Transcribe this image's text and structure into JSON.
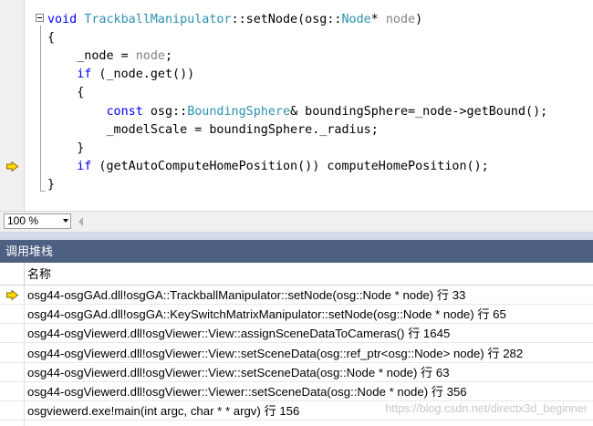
{
  "editor": {
    "lines": [
      {
        "tokens": [
          {
            "t": "void ",
            "c": "kw"
          },
          {
            "t": "TrackballManipulator",
            "c": "ty"
          },
          {
            "t": "::setNode(osg::",
            "c": ""
          },
          {
            "t": "Node",
            "c": "ty"
          },
          {
            "t": "* ",
            "c": ""
          },
          {
            "t": "node",
            "c": "gr"
          },
          {
            "t": ")",
            "c": ""
          }
        ]
      },
      {
        "tokens": [
          {
            "t": "{",
            "c": ""
          }
        ]
      },
      {
        "tokens": [
          {
            "t": "    _node = ",
            "c": ""
          },
          {
            "t": "node",
            "c": "gr"
          },
          {
            "t": ";",
            "c": ""
          }
        ]
      },
      {
        "tokens": [
          {
            "t": "    ",
            "c": ""
          },
          {
            "t": "if",
            "c": "kw"
          },
          {
            "t": " (_node.get())",
            "c": ""
          }
        ]
      },
      {
        "tokens": [
          {
            "t": "    {",
            "c": ""
          }
        ]
      },
      {
        "tokens": [
          {
            "t": "        ",
            "c": ""
          },
          {
            "t": "const",
            "c": "kw"
          },
          {
            "t": " osg::",
            "c": ""
          },
          {
            "t": "BoundingSphere",
            "c": "ty"
          },
          {
            "t": "& boundingSphere=_node->getBound();",
            "c": ""
          }
        ]
      },
      {
        "tokens": [
          {
            "t": "        _modelScale = boundingSphere._radius;",
            "c": ""
          }
        ]
      },
      {
        "tokens": [
          {
            "t": "    }",
            "c": ""
          }
        ]
      },
      {
        "tokens": [
          {
            "t": "    ",
            "c": ""
          },
          {
            "t": "if",
            "c": "kw"
          },
          {
            "t": " (getAutoComputeHomePosition()) computeHomePosition();",
            "c": ""
          }
        ]
      },
      {
        "tokens": [
          {
            "t": "}",
            "c": ""
          }
        ]
      }
    ],
    "current_line_index": 8,
    "current_line_icon": "yellow-arrow-icon"
  },
  "zoom": {
    "value": "100 %"
  },
  "call_stack": {
    "title": "调用堆栈",
    "column_name": "名称",
    "rows": [
      {
        "text": "osg44-osgGAd.dll!osgGA::TrackballManipulator::setNode(osg::Node * node) 行 33",
        "current": true
      },
      {
        "text": "osg44-osgGAd.dll!osgGA::KeySwitchMatrixManipulator::setNode(osg::Node * node) 行 65",
        "current": false
      },
      {
        "text": "osg44-osgViewerd.dll!osgViewer::View::assignSceneDataToCameras() 行 1645",
        "current": false
      },
      {
        "text": "osg44-osgViewerd.dll!osgViewer::View::setSceneData(osg::ref_ptr<osg::Node> node) 行 282",
        "current": false
      },
      {
        "text": "osg44-osgViewerd.dll!osgViewer::View::setSceneData(osg::Node * node) 行 63",
        "current": false
      },
      {
        "text": "osg44-osgViewerd.dll!osgViewer::Viewer::setSceneData(osg::Node * node) 行 356",
        "current": false
      },
      {
        "text": "osgviewerd.exe!main(int argc, char * * argv) 行 156",
        "current": false
      }
    ]
  },
  "watermark": "https://blog.csdn.net/directx3d_beginner",
  "colors": {
    "keyword": "#0000ff",
    "type": "#2b91af",
    "param": "#808080",
    "panel_title_bg": "#4d6082",
    "arrow_fill": "#ffd800"
  }
}
